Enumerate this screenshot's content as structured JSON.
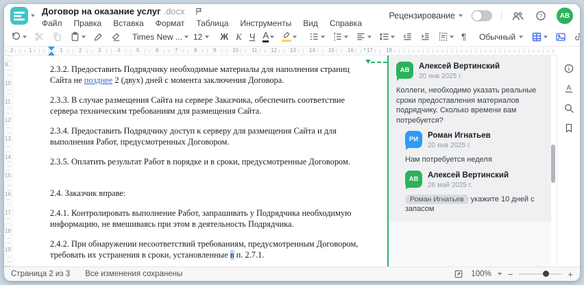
{
  "colors": {
    "logo_teal": "#3fc4c7",
    "accent_blue": "#3e6ff0",
    "comment_green": "#2bb35c",
    "comment_blue": "#2f9bf4",
    "anchor_green": "#2db36a",
    "tracked_change_blue": "#3b66c9"
  },
  "header": {
    "title": "Договор на оказание услуг",
    "title_ext": ".docx",
    "menu": [
      "Файл",
      "Правка",
      "Вставка",
      "Формат",
      "Таблица",
      "Инструменты",
      "Вид",
      "Справка"
    ],
    "review_label": "Рецензирование",
    "avatar_initials": "АВ"
  },
  "toolbar": {
    "font_name": "Times New ...",
    "font_size": "12",
    "bold": "Ж",
    "italic": "К",
    "underline": "Ч",
    "font_color_letter": "А",
    "pilcrow": "¶",
    "style_name": "Обычный",
    "more": "···"
  },
  "icons": {
    "header": [
      "flag-icon",
      "people-icon",
      "help-icon"
    ],
    "toolbar": [
      "undo-icon",
      "cut-icon",
      "copy-icon",
      "paste-icon",
      "format-painter-icon",
      "eraser-icon",
      "font-color-icon",
      "highlight-icon",
      "bullet-list-icon",
      "numbered-list-icon",
      "align-left-icon",
      "line-spacing-icon",
      "outdent-icon",
      "indent-icon",
      "paragraph-frame-icon",
      "table-icon",
      "image-icon",
      "link-icon",
      "comment-icon",
      "more-icon"
    ],
    "sidebar": [
      "info-icon",
      "spellcheck-icon",
      "search-icon",
      "bookmark-icon"
    ],
    "statusbar": [
      "fit-page-icon",
      "zoom-out-icon",
      "zoom-in-icon"
    ]
  },
  "ruler": {
    "left_numbers": [
      "2",
      "1"
    ],
    "numbers": [
      "1",
      "2",
      "3",
      "4",
      "5",
      "6",
      "7",
      "8",
      "9",
      "10",
      "11",
      "12",
      "13",
      "14",
      "15",
      "16",
      "17",
      "18"
    ],
    "vertical_numbers": [
      "9",
      "10",
      "11",
      "12",
      "13",
      "14",
      "15",
      "16",
      "17",
      "18",
      "19",
      "20"
    ]
  },
  "document": {
    "p232_pre": "2.3.2. Предоставить Подрядчику необходимые материалы для наполнения страниц Сайта не ",
    "p232_ins": "позднее",
    "p232_post": " 2 (двух) дней с момента заключения Договора.",
    "p233": "2.3.3. В случае размещения Сайта на сервере Заказчика, обеспечить соответствие сервера техническим требованиям для размещения Сайта.",
    "p234": "2.3.4. Предоставить Подрядчику доступ к серверу для размещения Сайта и для выполнения Работ, предусмотренных Договором.",
    "p235": "2.3.5. Оплатить результат Работ в порядке и в сроки, предусмотренные Договором.",
    "p24": "2.4. Заказчик вправе:",
    "p241": "2.4.1. Контролировать выполнение Работ, запрашивать у Подрядчика необходимую информацию, не вмешиваясь при этом в деятельность Подрядчика.",
    "p242_pre": "2.4.2. При обнаружении несоответствий требованиям, предусмотренным Договором, требовать их устранения в сроки, установленные ",
    "p242_hl": "в",
    "p242_post": " п. 2.7.1."
  },
  "comments": {
    "thread": [
      {
        "initials": "АВ",
        "avatar_color": "#2bb35c",
        "author": "Алексей Вертинский",
        "date": "20 янв 2025 г.",
        "text": "Коллеги, необходимо указать реальные сроки предоставления материалов подрядчику. Сколько времени вам потребуется?",
        "reply": false
      },
      {
        "initials": "РИ",
        "avatar_color": "#2f9bf4",
        "author": "Роман Игнатьев",
        "date": "20 янв 2025 г.",
        "text": "Нам потребуется неделя",
        "reply": true
      },
      {
        "initials": "АВ",
        "avatar_color": "#2bb35c",
        "author": "Алексей Вертинский",
        "date": "26 май 2025 г.",
        "mention": "Роман Игнатьев",
        "text": "укажите 10 дней с запасом",
        "reply": true
      }
    ]
  },
  "statusbar": {
    "page_info": "Страница 2 из 3",
    "saved_info": "Все изменения сохранены",
    "zoom_value": "100%"
  }
}
